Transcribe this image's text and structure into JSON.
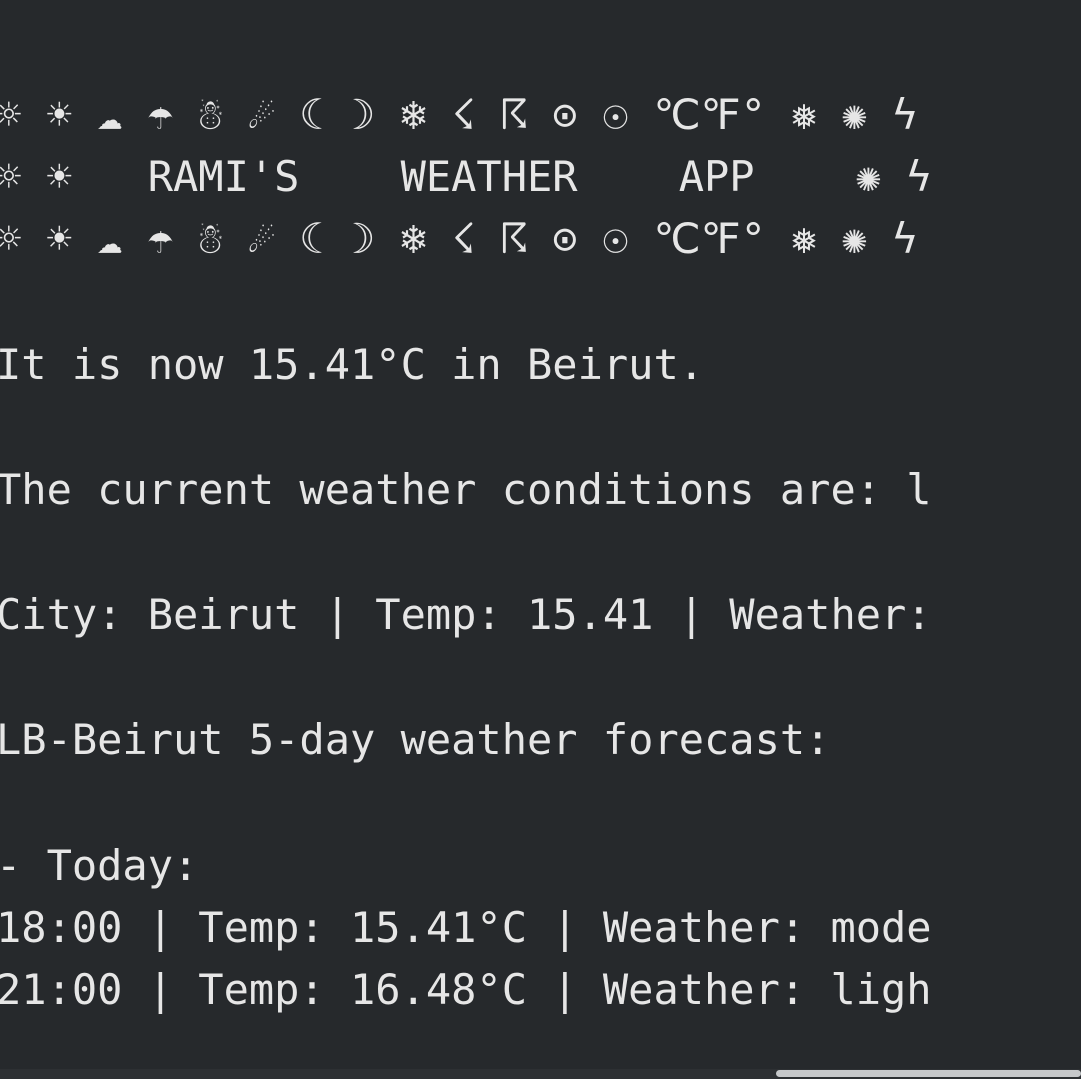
{
  "terminal": {
    "banner": {
      "symbols_top": "☼ ☀ ☁ ☂ ☃ ☄ ☾ ☽ ❄ ☇ ☈ ⊙ ☉ ℃℉° ❅ ✺ ϟ",
      "title_line": "☼ ☀   RAMI'S    WEATHER    APP    ✺ ϟ",
      "symbols_bottom": "☼ ☀ ☁ ☂ ☃ ☄ ☾ ☽ ❄ ☇ ☈ ⊙ ☉ ℃℉° ❅ ✺ ϟ"
    },
    "now_line": "It is now 15.41°C in Beirut.",
    "conditions_line": "The current weather conditions are: l",
    "summary_line": "City: Beirut | Temp: 15.41 | Weather:",
    "forecast_header": "LB-Beirut 5-day weather forecast:",
    "today_label": "- Today:",
    "forecast_rows": [
      "18:00 | Temp: 15.41°C | Weather: mode",
      "21:00 | Temp: 16.48°C | Weather: ligh"
    ]
  }
}
